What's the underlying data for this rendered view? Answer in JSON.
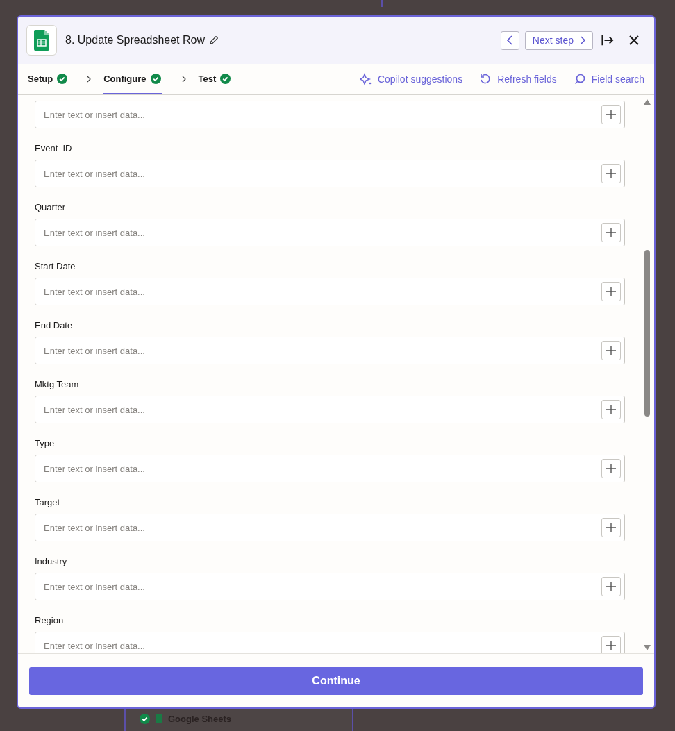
{
  "background_card": {
    "title": "Google Sheets"
  },
  "modal": {
    "title": "8. Update Spreadsheet Row",
    "nav": {
      "next_label": "Next step"
    },
    "steps": [
      {
        "label": "Setup",
        "selected": false,
        "done": true
      },
      {
        "label": "Configure",
        "selected": true,
        "done": true
      },
      {
        "label": "Test",
        "selected": false,
        "done": true
      }
    ],
    "actions": [
      {
        "kind": "copilot",
        "label": "Copilot suggestions"
      },
      {
        "kind": "refresh",
        "label": "Refresh fields"
      },
      {
        "kind": "search",
        "label": "Field search"
      }
    ],
    "fields": [
      {
        "placeholder": "Enter text or insert data..."
      },
      {
        "label": "Event_ID",
        "placeholder": "Enter text or insert data..."
      },
      {
        "label": "Quarter",
        "placeholder": "Enter text or insert data..."
      },
      {
        "label": "Start Date",
        "placeholder": "Enter text or insert data..."
      },
      {
        "label": "End Date",
        "placeholder": "Enter text or insert data..."
      },
      {
        "label": "Mktg Team",
        "placeholder": "Enter text or insert data..."
      },
      {
        "label": "Type",
        "placeholder": "Enter text or insert data..."
      },
      {
        "label": "Target",
        "placeholder": "Enter text or insert data..."
      },
      {
        "label": "Industry",
        "placeholder": "Enter text or insert data..."
      },
      {
        "label": "Region",
        "placeholder": "Enter text or insert data..."
      }
    ],
    "continue_button": "Continue"
  }
}
